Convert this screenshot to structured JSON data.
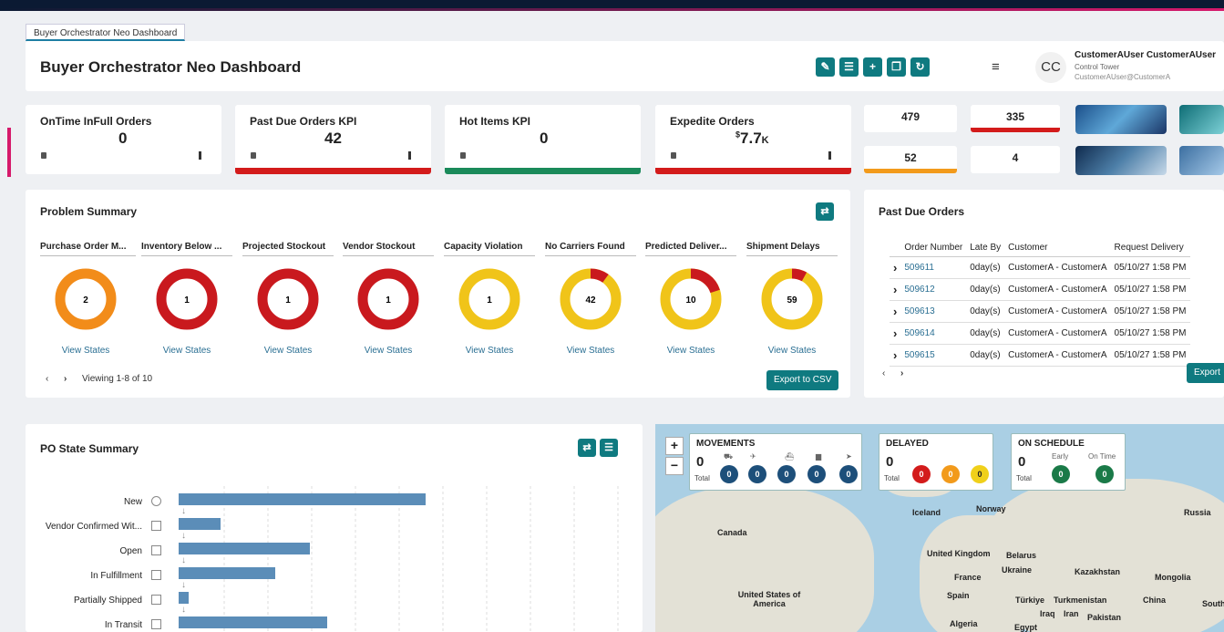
{
  "tab": "Buyer Orchestrator Neo Dashboard",
  "header": {
    "title": "Buyer Orchestrator Neo Dashboard",
    "avatar_initials": "CC",
    "user_name": "CustomerAUser CustomerAUser",
    "user_role": "Control Tower",
    "user_email": "CustomerAUser@CustomerA"
  },
  "kpis": [
    {
      "title": "OnTime InFull Orders",
      "value": "0",
      "color": ""
    },
    {
      "title": "Past Due Orders KPI",
      "value": "42",
      "color": "#d31b1b"
    },
    {
      "title": "Hot Items KPI",
      "value": "0",
      "color": "#1a8a5a"
    },
    {
      "title": "Expedite Orders",
      "value_prefix": "$",
      "value": "7.7",
      "value_suffix": "K",
      "color": "#d31b1b"
    }
  ],
  "mini_tiles": [
    {
      "value": "479",
      "color": ""
    },
    {
      "value": "335",
      "color": "#d31b1b"
    },
    {
      "value": "52",
      "color": "#f29a1b"
    },
    {
      "value": "4",
      "color": ""
    }
  ],
  "problem_summary": {
    "title": "Problem Summary",
    "columns": [
      {
        "label": "Purchase Order M...",
        "value": "2",
        "color": "#f28c1a",
        "red_fraction": 0
      },
      {
        "label": "Inventory Below ...",
        "value": "1",
        "color": "#c9191e",
        "red_fraction": 0
      },
      {
        "label": "Projected Stockout",
        "value": "1",
        "color": "#c9191e",
        "red_fraction": 0
      },
      {
        "label": "Vendor Stockout",
        "value": "1",
        "color": "#c9191e",
        "red_fraction": 0
      },
      {
        "label": "Capacity Violation",
        "value": "1",
        "color": "#f0c419",
        "red_fraction": 0
      },
      {
        "label": "No Carriers Found",
        "value": "42",
        "color": "#f0c419",
        "red_fraction": 0.1
      },
      {
        "label": "Predicted Deliver...",
        "value": "10",
        "color": "#f0c419",
        "red_fraction": 0.2
      },
      {
        "label": "Shipment Delays",
        "value": "59",
        "color": "#f0c419",
        "red_fraction": 0.08
      }
    ],
    "view_states": "View States",
    "viewing": "Viewing 1-8 of 10",
    "export": "Export to CSV"
  },
  "past_due": {
    "title": "Past Due Orders",
    "headers": [
      "Order Number",
      "Late By",
      "Customer",
      "Request Delivery"
    ],
    "rows": [
      {
        "order": "509611",
        "late": "0day(s)",
        "customer": "CustomerA - CustomerA",
        "date": "05/10/27 1:58 PM"
      },
      {
        "order": "509612",
        "late": "0day(s)",
        "customer": "CustomerA - CustomerA",
        "date": "05/10/27 1:58 PM"
      },
      {
        "order": "509613",
        "late": "0day(s)",
        "customer": "CustomerA - CustomerA",
        "date": "05/10/27 1:58 PM"
      },
      {
        "order": "509614",
        "late": "0day(s)",
        "customer": "CustomerA - CustomerA",
        "date": "05/10/27 1:58 PM"
      },
      {
        "order": "509615",
        "late": "0day(s)",
        "customer": "CustomerA - CustomerA",
        "date": "05/10/27 1:58 PM"
      }
    ],
    "export": "Export"
  },
  "po_state": {
    "title": "PO State Summary",
    "rows": [
      {
        "label": "New",
        "value": 100
      },
      {
        "label": "Vendor Confirmed Wit...",
        "value": 17
      },
      {
        "label": "Open",
        "value": 53
      },
      {
        "label": "In Fulfillment",
        "value": 39
      },
      {
        "label": "Partially Shipped",
        "value": 4
      },
      {
        "label": "In Transit",
        "value": 60
      }
    ]
  },
  "map": {
    "movements": {
      "title": "MOVEMENTS",
      "total": "0",
      "total_label": "Total",
      "values": [
        "0",
        "0",
        "0",
        "0",
        "0"
      ]
    },
    "delayed": {
      "title": "DELAYED",
      "total": "0",
      "total_label": "Total",
      "values": [
        "0",
        "0",
        "0"
      ]
    },
    "on_schedule": {
      "title": "ON SCHEDULE",
      "total": "0",
      "total_label": "Total",
      "early": "Early",
      "on_time": "On Time",
      "values": [
        "0",
        "0"
      ]
    },
    "places": [
      "Iceland",
      "Norway",
      "Russia",
      "Canada",
      "United Kingdom",
      "Belarus",
      "France",
      "Ukraine",
      "Kazakhstan",
      "Mongolia",
      "Spain",
      "Türkiye",
      "Turkmenistan",
      "China",
      "United States of America",
      "Iraq",
      "Iran",
      "Pakistan",
      "Algeria",
      "Egypt",
      "South"
    ]
  }
}
